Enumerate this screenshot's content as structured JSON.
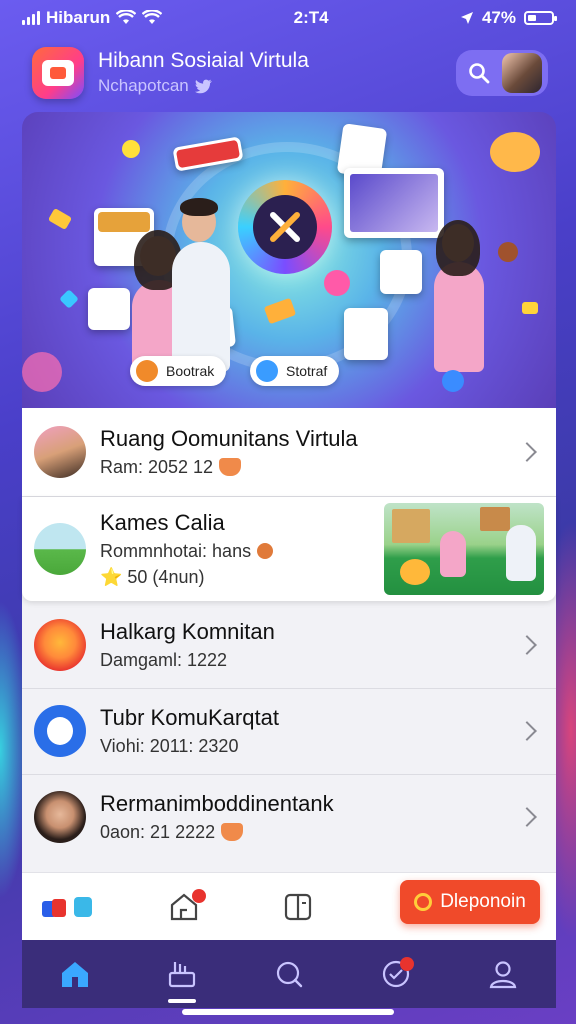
{
  "status_bar": {
    "carrier": "Hibarun",
    "time": "2:T4",
    "battery": "47%"
  },
  "header": {
    "title": "Hibann Sosiaial Virtula",
    "subtitle": "Nchapotcan"
  },
  "hero": {
    "pill_left": "Bootrak",
    "pill_right": "Stotraf"
  },
  "list": {
    "items": [
      {
        "title": "Ruang Oomunitans Virtula",
        "meta": "Ram: 2052 12"
      },
      {
        "title": "Kames Calia",
        "meta": "Rommnhotai: hans",
        "meta2": "⭐ 50 (4nun)"
      },
      {
        "title": "Halkarg Komnitan",
        "meta": "Damgaml: 1222"
      },
      {
        "title": "Tubr KomuKarqtat",
        "meta": "Viohi: 2011: 2320"
      },
      {
        "title": "Rermanimboddinentank",
        "meta": "0aon: 21 2222"
      }
    ]
  },
  "quick_bar": {
    "cta_label": "Dleponoin"
  },
  "colors": {
    "accent": "#f04a2a",
    "tab_bar": "#3a2d7a",
    "header_pill": "#7d6ef2"
  },
  "icons": {
    "header": [
      "search-icon",
      "twitter-bird-icon"
    ],
    "tabs": [
      "home-icon",
      "bookmarks-icon",
      "search-icon",
      "activity-icon",
      "profile-icon"
    ]
  }
}
